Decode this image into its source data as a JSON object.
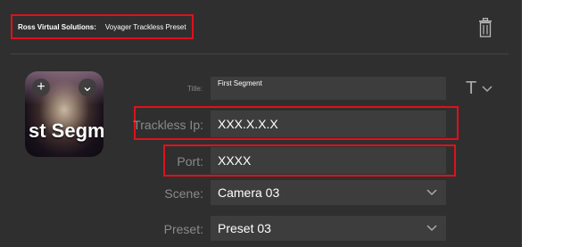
{
  "header": {
    "brand": "Ross Virtual Solutions:",
    "preset_name": "Voyager Trackless Preset"
  },
  "thumbnail": {
    "caption": "st Segm",
    "add_glyph": "+",
    "menu_glyph": "⌄"
  },
  "fields": {
    "title": {
      "label": "Title:",
      "value": "First Segment"
    },
    "trackless_ip": {
      "label": "Trackless Ip:",
      "value": "XXX.X.X.X"
    },
    "port": {
      "label": "Port:",
      "value": "XXXX"
    },
    "scene": {
      "label": "Scene:",
      "value": "Camera 03"
    },
    "preset": {
      "label": "Preset:",
      "value": "Preset 03"
    }
  },
  "text_tool": {
    "glyph": "T"
  },
  "icons": {
    "delete": "trash-icon",
    "text_style": "text-format-icon",
    "dropdown": "chevron-down-icon"
  },
  "colors": {
    "highlight": "#e0101c",
    "panel_bg": "#2f2f2f",
    "field_bg": "#3d3d3d",
    "label": "#8a8a8a"
  }
}
